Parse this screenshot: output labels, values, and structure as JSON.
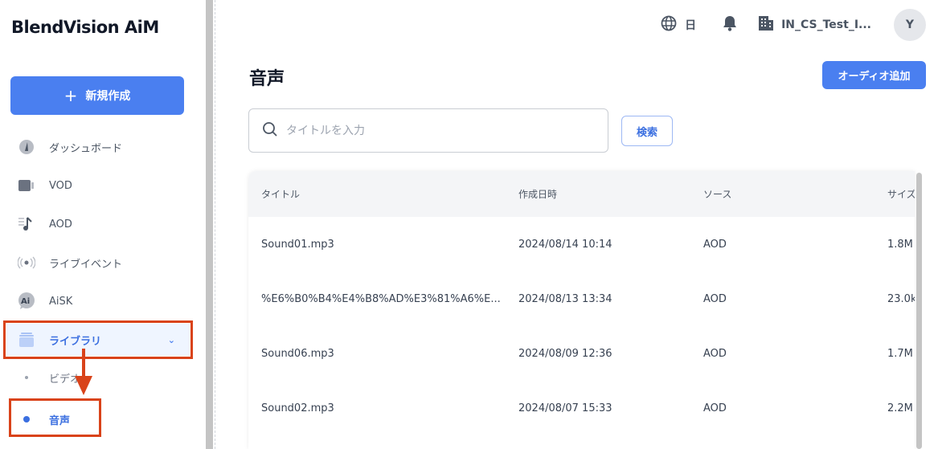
{
  "app": {
    "logo": "BlendVision AiM"
  },
  "sidebar": {
    "new_button": "新規作成",
    "items": [
      {
        "label": "ダッシュボード",
        "icon": "dashboard-gauge-icon"
      },
      {
        "label": "VOD",
        "icon": "video-camera-icon"
      },
      {
        "label": "AOD",
        "icon": "music-note-icon"
      },
      {
        "label": "ライブイベント",
        "icon": "broadcast-icon"
      },
      {
        "label": "AiSK",
        "icon": "ai-chat-icon"
      },
      {
        "label": "ライブラリ",
        "icon": "library-stack-icon",
        "active": true,
        "expanded": true
      }
    ],
    "subitems": [
      {
        "label": "ビデオ"
      },
      {
        "label": "音声",
        "active": true
      }
    ]
  },
  "header": {
    "language": "日",
    "org": "IN_CS_Test_I...",
    "avatar": "Y"
  },
  "main": {
    "title": "音声",
    "add_button": "オーディオ追加",
    "search": {
      "placeholder": "タイトルを入力",
      "value": "",
      "button": "検索"
    },
    "table": {
      "columns": [
        "タイトル",
        "作成日時",
        "ソース",
        "サイズ"
      ],
      "rows": [
        [
          "Sound01.mp3",
          "2024/08/14 10:14",
          "AOD",
          "1.8M"
        ],
        [
          "%E6%B0%B4%E4%B8%AD%E3%81%A6%E...",
          "2024/08/13 13:34",
          "AOD",
          "23.0k"
        ],
        [
          "Sound06.mp3",
          "2024/08/09 12:36",
          "AOD",
          "1.7M"
        ],
        [
          "Sound02.mp3",
          "2024/08/07 15:33",
          "AOD",
          "2.2M"
        ]
      ]
    }
  },
  "colors": {
    "accent": "#4a7ff0",
    "highlight": "#d9431a"
  }
}
